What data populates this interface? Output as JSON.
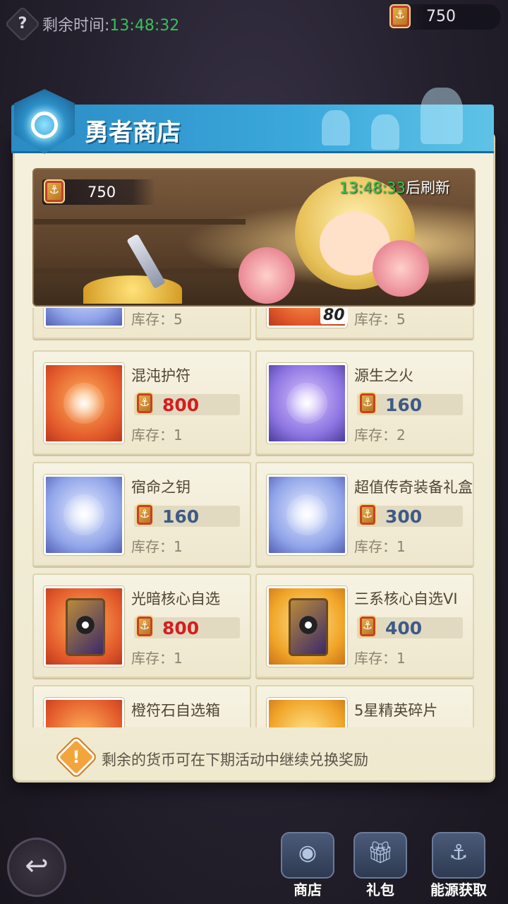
{
  "top_bar": {
    "help_icon": "question-mark-icon",
    "remaining_label": "剩余时间:",
    "remaining_time": "13:48:32",
    "currency_amount": "750"
  },
  "shop": {
    "title": "勇者商店",
    "balance": "750",
    "refresh_time": "13:48:33",
    "refresh_suffix": "后刷新"
  },
  "items": [
    {
      "name": "",
      "price": "",
      "stock_label": "库存：",
      "stock": "5",
      "icon": "scroll-item-icon",
      "price_color": "blue"
    },
    {
      "name": "",
      "price": "",
      "stock_label": "库存：",
      "stock": "5",
      "icon": "bundle-item-icon",
      "price_color": "blue",
      "badge": "80"
    },
    {
      "name": "混沌护符",
      "price": "800",
      "stock_label": "库存：",
      "stock": "1",
      "icon": "chaos-amulet-icon",
      "price_color": "red"
    },
    {
      "name": "源生之火",
      "price": "160",
      "stock_label": "库存：",
      "stock": "2",
      "icon": "origin-fire-icon",
      "price_color": "blue"
    },
    {
      "name": "宿命之钥",
      "price": "160",
      "stock_label": "库存：",
      "stock": "1",
      "icon": "fate-key-icon",
      "price_color": "blue"
    },
    {
      "name": "超值传奇装备礼盒",
      "price": "300",
      "stock_label": "库存：",
      "stock": "1",
      "icon": "legendary-armor-icon",
      "price_color": "blue"
    },
    {
      "name": "光暗核心自选",
      "price": "800",
      "stock_label": "库存：",
      "stock": "1",
      "icon": "light-dark-core-icon",
      "price_color": "red"
    },
    {
      "name": "三系核心自选VI",
      "price": "400",
      "stock_label": "库存：",
      "stock": "1",
      "icon": "tri-core-icon",
      "price_color": "blue"
    },
    {
      "name": "橙符石自选箱",
      "price": "",
      "stock_label": "",
      "stock": "",
      "icon": "orange-rune-box-icon",
      "price_color": "blue"
    },
    {
      "name": "5星精英碎片",
      "price": "",
      "stock_label": "",
      "stock": "",
      "icon": "elite-shard-icon",
      "price_color": "blue"
    }
  ],
  "notice": "剩余的货币可在下期活动中继续兑换奖励",
  "bottom_nav": [
    {
      "label": "商店",
      "icon": "shop-icon"
    },
    {
      "label": "礼包",
      "icon": "gift-icon"
    },
    {
      "label": "能源获取",
      "icon": "anchor-chest-icon"
    }
  ],
  "colors": {
    "price_red": "#d61d1d",
    "price_blue": "#3f5a86",
    "time_green": "#39c05a",
    "banner_blue": "#3ba8dc"
  }
}
